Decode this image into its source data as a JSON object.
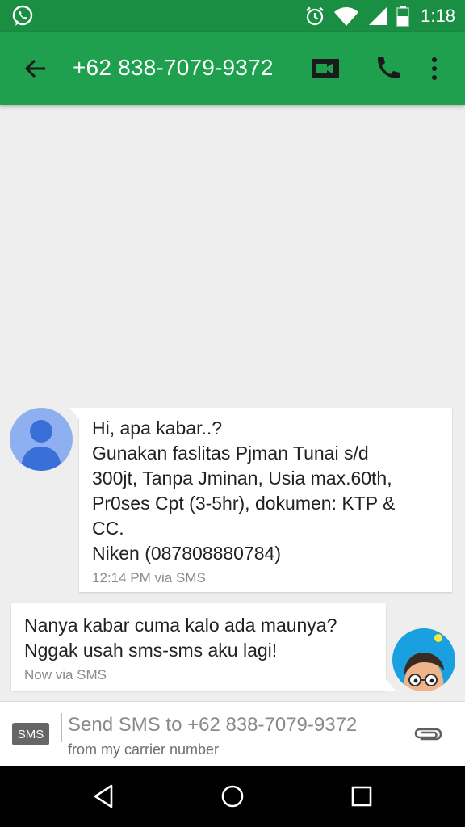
{
  "status_bar": {
    "time": "1:18",
    "icons": [
      "whatsapp-icon",
      "alarm-icon",
      "wifi-icon",
      "signal-icon",
      "battery-icon"
    ]
  },
  "app_bar": {
    "title": "+62 838-7079-9372",
    "actions": [
      "video-call-icon",
      "phone-icon",
      "more-vert-icon"
    ],
    "color": "#1fa04f"
  },
  "messages": [
    {
      "direction": "incoming",
      "lines": [
        "Hi, apa kabar..?",
        "Gunakan faslitas Pjman Tunai s/d",
        "300jt, Tanpa Jminan, Usia max.60th,",
        "Pr0ses Cpt (3-5hr), dokumen: KTP &",
        "CC.",
        "Niken (087808880784)"
      ],
      "meta": "12:14 PM via SMS"
    },
    {
      "direction": "outgoing",
      "lines": [
        "Nanya kabar cuma kalo ada maunya?",
        "Nggak usah sms-sms aku lagi!"
      ],
      "meta": "Now via SMS"
    }
  ],
  "compose": {
    "badge": "SMS",
    "placeholder": "Send SMS to +62 838-7079-9372",
    "sub": "from my carrier number"
  },
  "nav_bar": {
    "buttons": [
      "back-nav-icon",
      "home-nav-icon",
      "recents-nav-icon"
    ]
  }
}
